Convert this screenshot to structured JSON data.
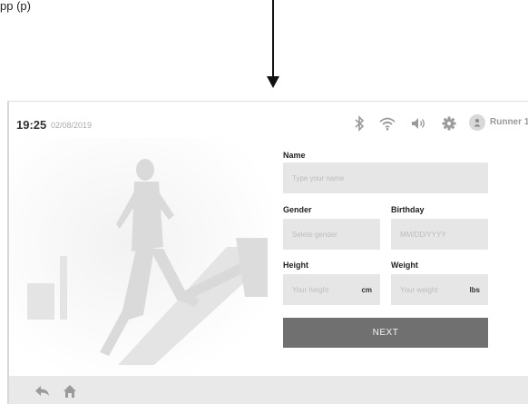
{
  "caption": "pp (p)",
  "status": {
    "time": "19:25",
    "date": "02/08/2019",
    "icons": [
      "bluetooth-icon",
      "wifi-icon",
      "volume-icon",
      "settings-gear-icon"
    ],
    "user_name": "Runner 1"
  },
  "form": {
    "name_label": "Name",
    "name_placeholder": "Type your name",
    "gender_label": "Gender",
    "gender_placeholder": "Selete gender",
    "birthday_label": "Birthday",
    "birthday_placeholder": "MM/DD/YYYY",
    "height_label": "Height",
    "height_placeholder": "Your height",
    "height_unit": "cm",
    "weight_label": "Weight",
    "weight_placeholder": "Your weight",
    "weight_unit": "lbs",
    "next_label": "NEXT"
  },
  "bottom_bar": {
    "icons": [
      "back-arrow-icon",
      "home-icon"
    ]
  },
  "colors": {
    "field_bg": "#e6e6e6",
    "button_bg": "#707070",
    "bottom_bar_bg": "#e9e9e9",
    "icon_gray": "#9a9a9a"
  }
}
